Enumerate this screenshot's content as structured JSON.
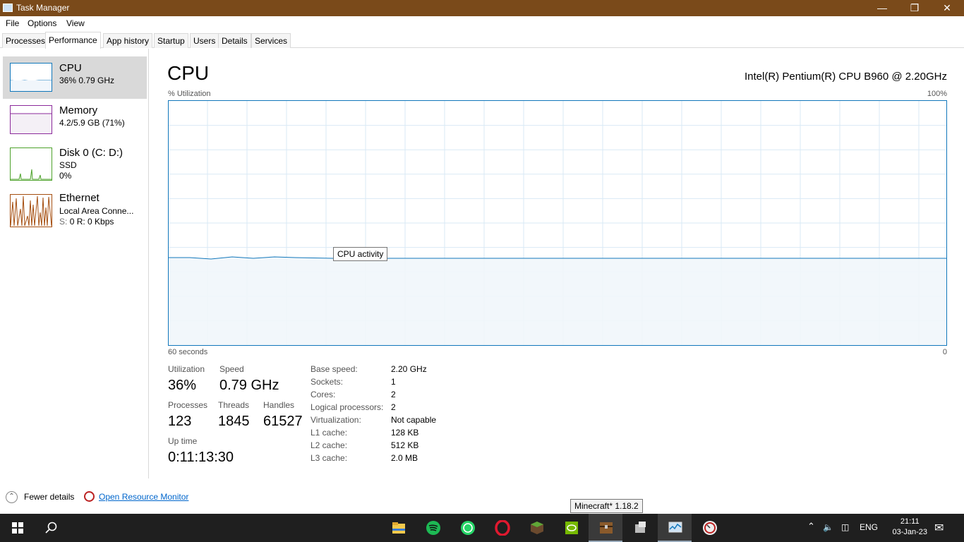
{
  "window": {
    "title": "Task Manager",
    "colors": {
      "titlebar": "#7a4a1a"
    }
  },
  "menu": {
    "file": "File",
    "options": "Options",
    "view": "View"
  },
  "tabs": [
    "Processes",
    "Performance",
    "App history",
    "Startup",
    "Users",
    "Details",
    "Services"
  ],
  "sidebar": {
    "cpu": {
      "title": "CPU",
      "sub": "36% 0.79 GHz"
    },
    "memory": {
      "title": "Memory",
      "sub": "4.2/5.9 GB (71%)"
    },
    "disk": {
      "title": "Disk 0 (C: D:)",
      "sub": "SSD",
      "sub2": "0%"
    },
    "ethernet": {
      "title": "Ethernet",
      "sub": "Local Area Conne...",
      "sub2_prefix": "S:",
      "sub2_rest": "0 R: 0 Kbps"
    }
  },
  "main": {
    "title": "CPU",
    "model": "Intel(R) Pentium(R) CPU B960 @ 2.20GHz",
    "graph_label_left": "% Utilization",
    "graph_label_right": "100%",
    "axis_left": "60 seconds",
    "axis_right": "0",
    "tooltip": "CPU activity",
    "stats": {
      "utilization_label": "Utilization",
      "utilization": "36%",
      "speed_label": "Speed",
      "speed": "0.79 GHz",
      "processes_label": "Processes",
      "processes": "123",
      "threads_label": "Threads",
      "threads": "1845",
      "handles_label": "Handles",
      "handles": "61527",
      "uptime_label": "Up time",
      "uptime": "0:11:13:30"
    },
    "specs": [
      {
        "label": "Base speed:",
        "value": "2.20 GHz"
      },
      {
        "label": "Sockets:",
        "value": "1"
      },
      {
        "label": "Cores:",
        "value": "2"
      },
      {
        "label": "Logical processors:",
        "value": "2"
      },
      {
        "label": "Virtualization:",
        "value": "Not capable"
      },
      {
        "label": "L1 cache:",
        "value": "128 KB"
      },
      {
        "label": "L2 cache:",
        "value": "512 KB"
      },
      {
        "label": "L3 cache:",
        "value": "2.0 MB"
      }
    ]
  },
  "footer": {
    "fewer_details": "Fewer details",
    "open_resource_monitor": "Open Resource Monitor"
  },
  "taskbar_tooltip": "Minecraft* 1.18.2",
  "taskbar": {
    "apps": [
      "start-icon",
      "search-icon",
      "file-explorer-icon",
      "spotify-icon",
      "whatsapp-icon",
      "opera-icon",
      "minecraft-icon",
      "nvidia-icon",
      "minecraft-launcher-icon",
      "app-icon",
      "task-manager-icon",
      "clock-app-icon"
    ],
    "lang": "ENG",
    "time": "21:11",
    "date": "03-Jan-23"
  }
}
